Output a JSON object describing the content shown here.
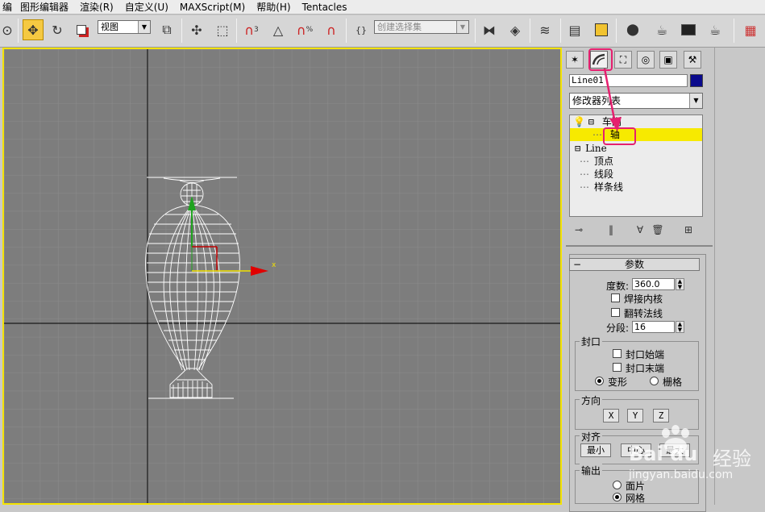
{
  "menubar": {
    "items": [
      "图形编辑器",
      "渲染(R)",
      "自定义(U)",
      "MAXScript(M)",
      "帮助(H)",
      "Tentacles"
    ]
  },
  "toolbar": {
    "coord_dropdown": "视图",
    "selection_set_placeholder": "创建选择集",
    "snap_value": "3",
    "percent_snap": "%"
  },
  "viewport": {
    "axis_x_label": "x"
  },
  "panel": {
    "object_name": "Line01",
    "object_color": "#0a0a8c",
    "modifier_list": "修改器列表",
    "stack": {
      "lathe": "车削",
      "axis": "轴",
      "line": "Line",
      "vertex": "顶点",
      "segment": "线段",
      "spline": "样条线"
    },
    "params": {
      "title": "参数",
      "degrees_label": "度数:",
      "degrees_value": "360.0",
      "weld_core": "焊接内核",
      "flip_normals": "翻转法线",
      "segments_label": "分段:",
      "segments_value": "16",
      "capping_title": "封口",
      "cap_start": "封口始端",
      "cap_end": "封口末端",
      "morph": "变形",
      "grid": "栅格",
      "direction_title": "方向",
      "dir_x": "X",
      "dir_y": "Y",
      "dir_z": "Z",
      "align_title": "对齐",
      "align_min": "最小",
      "align_center": "中心",
      "align_max": "最大",
      "output_title": "输出",
      "output_patch": "面片",
      "output_mesh": "网格"
    }
  },
  "watermark": {
    "brand": "Bai du",
    "suffix": "经验",
    "url": "jingyan.baidu.com"
  },
  "colors": {
    "highlight": "#f7ea00",
    "callout": "#e5206f",
    "viewport_bg": "#7d7d7d",
    "viewport_border": "#f4e300"
  }
}
